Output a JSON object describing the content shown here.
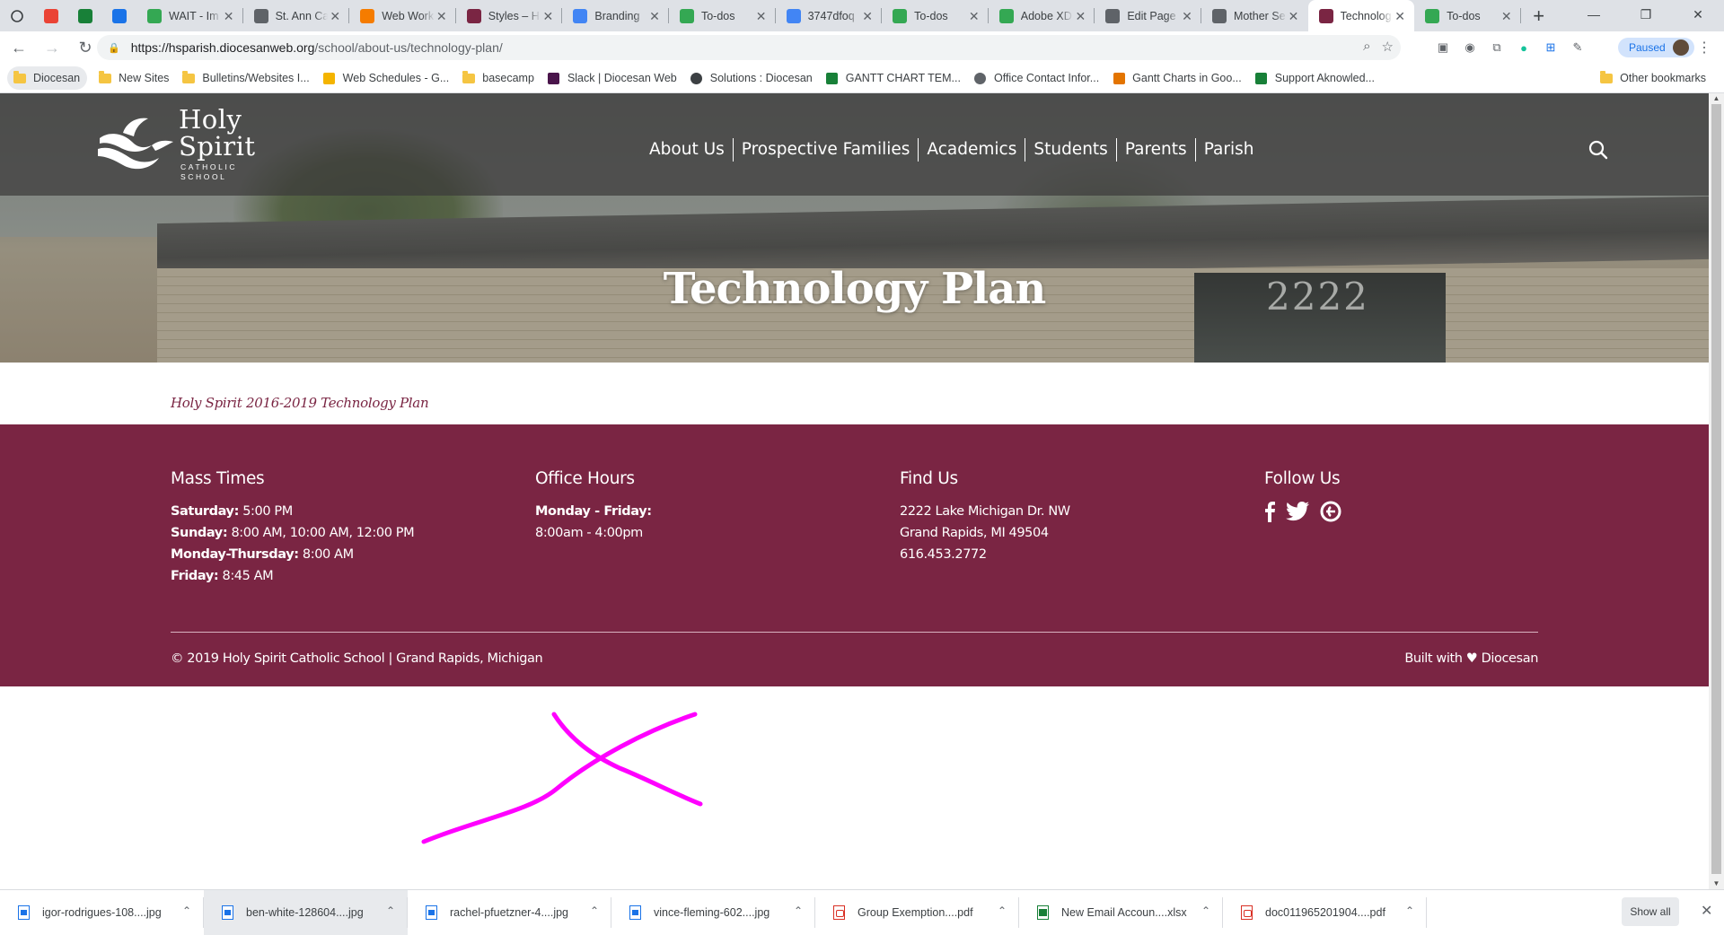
{
  "browser": {
    "tabs": [
      {
        "title": "",
        "favicon": "gmail-icon",
        "color": "#ea4335"
      },
      {
        "title": "",
        "favicon": "sheets-icon",
        "color": "#188038"
      },
      {
        "title": "",
        "favicon": "calendar-icon",
        "color": "#1a73e8"
      },
      {
        "title": "WAIT - Im",
        "favicon": "basecamp-icon",
        "color": "#34a853"
      },
      {
        "title": "St. Ann Ca",
        "favicon": "feather-icon",
        "color": "#5f6368"
      },
      {
        "title": "Web Work",
        "favicon": "grid-icon",
        "color": "#f57c00"
      },
      {
        "title": "Styles – H",
        "favicon": "dove-icon",
        "color": "#7a2543"
      },
      {
        "title": "Branding",
        "favicon": "docs-icon",
        "color": "#4285f4"
      },
      {
        "title": "To-dos",
        "favicon": "basecamp-icon",
        "color": "#34a853"
      },
      {
        "title": "3747dfoq",
        "favicon": "circle-icon",
        "color": "#4285f4"
      },
      {
        "title": "To-dos",
        "favicon": "basecamp-icon",
        "color": "#34a853"
      },
      {
        "title": "Adobe XD",
        "favicon": "basecamp-icon",
        "color": "#34a853"
      },
      {
        "title": "Edit Page",
        "favicon": "page-icon",
        "color": "#5f6368"
      },
      {
        "title": "Mother Se",
        "favicon": "page-icon",
        "color": "#5f6368"
      },
      {
        "title": "Technolog",
        "favicon": "dove-icon",
        "color": "#7a2543",
        "active": true
      },
      {
        "title": "To-dos",
        "favicon": "basecamp-icon",
        "color": "#34a853"
      }
    ],
    "url_host": "https://hsparish.diocesanweb.org",
    "url_path": "/school/about-us/technology-plan/",
    "profile_status": "Paused",
    "bookmarks": [
      {
        "label": "Diocesan",
        "icon": "folder-icon"
      },
      {
        "label": "New Sites",
        "icon": "folder-icon"
      },
      {
        "label": "Bulletins/Websites I...",
        "icon": "folder-icon"
      },
      {
        "label": "Web Schedules - G...",
        "icon": "drive-icon"
      },
      {
        "label": "basecamp",
        "icon": "folder-icon"
      },
      {
        "label": "Slack | Diocesan Web",
        "icon": "slack-icon"
      },
      {
        "label": "Solutions : Diocesan",
        "icon": "clock-icon"
      },
      {
        "label": "GANTT CHART TEM...",
        "icon": "sheets-icon"
      },
      {
        "label": "Office Contact Infor...",
        "icon": "at-icon"
      },
      {
        "label": "Gantt Charts in Goo...",
        "icon": "gantt-icon"
      },
      {
        "label": "Support Aknowled...",
        "icon": "sheets-icon"
      }
    ],
    "other_bookmarks": "Other bookmarks"
  },
  "site": {
    "logo": {
      "line1": "Holy",
      "line2": "Spirit",
      "sub1": "CATHOLIC",
      "sub2": "SCHOOL"
    },
    "nav": [
      "About Us",
      "Prospective Families",
      "Academics",
      "Students",
      "Parents",
      "Parish"
    ],
    "hero_title": "Technology Plan",
    "hero_address": "2222",
    "content_link": "Holy Spirit 2016-2019 Technology Plan",
    "brand_color": "#7a2543",
    "footer": {
      "mass": {
        "title": "Mass Times",
        "rows": [
          {
            "label": "Saturday:",
            "value": " 5:00 PM"
          },
          {
            "label": "Sunday:",
            "value": " 8:00 AM, 10:00 AM, 12:00 PM"
          },
          {
            "label": "Monday-Thursday:",
            "value": " 8:00 AM"
          },
          {
            "label": "Friday:",
            "value": " 8:45 AM"
          }
        ]
      },
      "office": {
        "title": "Office Hours",
        "label": "Monday - Friday:",
        "value": "8:00am - 4:00pm"
      },
      "find": {
        "title": "Find Us",
        "street": "2222 Lake Michigan Dr. NW",
        "city": "Grand Rapids, MI 49504",
        "phone": "616.453.2772"
      },
      "follow": {
        "title": "Follow Us",
        "icons": [
          "facebook-icon",
          "twitter-icon",
          "flocknote-icon"
        ]
      },
      "copyright": "© 2019 Holy Spirit Catholic School | Grand Rapids, Michigan",
      "built": "Built with ♥ Diocesan"
    }
  },
  "annotation_color": "#ff00ff",
  "downloads": [
    {
      "name": "igor-rodrigues-108....jpg",
      "type": "jpg"
    },
    {
      "name": "ben-white-128604....jpg",
      "type": "jpg",
      "highlight": true
    },
    {
      "name": "rachel-pfuetzner-4....jpg",
      "type": "jpg"
    },
    {
      "name": "vince-fleming-602....jpg",
      "type": "jpg"
    },
    {
      "name": "Group Exemption....pdf",
      "type": "pdf"
    },
    {
      "name": "New Email Accoun....xlsx",
      "type": "xlsx"
    },
    {
      "name": "doc011965201904....pdf",
      "type": "pdf"
    }
  ],
  "show_all": "Show all"
}
